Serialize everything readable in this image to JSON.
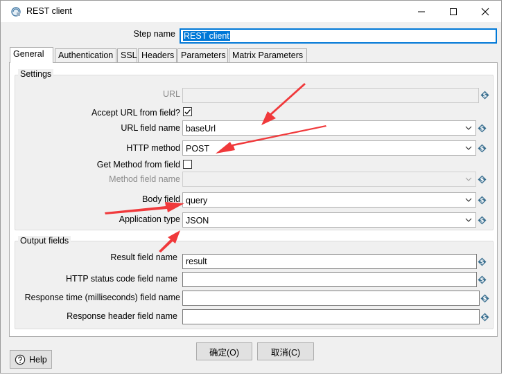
{
  "window": {
    "title": "REST client"
  },
  "step": {
    "label": "Step name",
    "value": "REST client"
  },
  "tabs": [
    "General",
    "Authentication",
    "SSL",
    "Headers",
    "Parameters",
    "Matrix Parameters"
  ],
  "settings": {
    "title": "Settings",
    "url_label": "URL",
    "url_value": "",
    "accept_url_label": "Accept URL from field?",
    "accept_url_checked": true,
    "url_field_label": "URL field name",
    "url_field_value": "baseUrl",
    "http_method_label": "HTTP method",
    "http_method_value": "POST",
    "get_method_label": "Get Method from field",
    "get_method_checked": false,
    "method_field_label": "Method field name",
    "method_field_value": "",
    "body_field_label": "Body field",
    "body_field_value": "query",
    "app_type_label": "Application type",
    "app_type_value": "JSON"
  },
  "output": {
    "title": "Output fields",
    "result_label": "Result field name",
    "result_value": "result",
    "status_label": "HTTP status code field name",
    "status_value": "",
    "response_time_label": "Response time (milliseconds) field name",
    "response_time_value": "",
    "response_header_label": "Response header field name",
    "response_header_value": ""
  },
  "buttons": {
    "ok": "确定(O)",
    "cancel": "取消(C)",
    "help": "Help"
  },
  "colors": {
    "accent": "#0078d7",
    "arrow": "#f0393b",
    "dollar": "#3a6f8f"
  }
}
